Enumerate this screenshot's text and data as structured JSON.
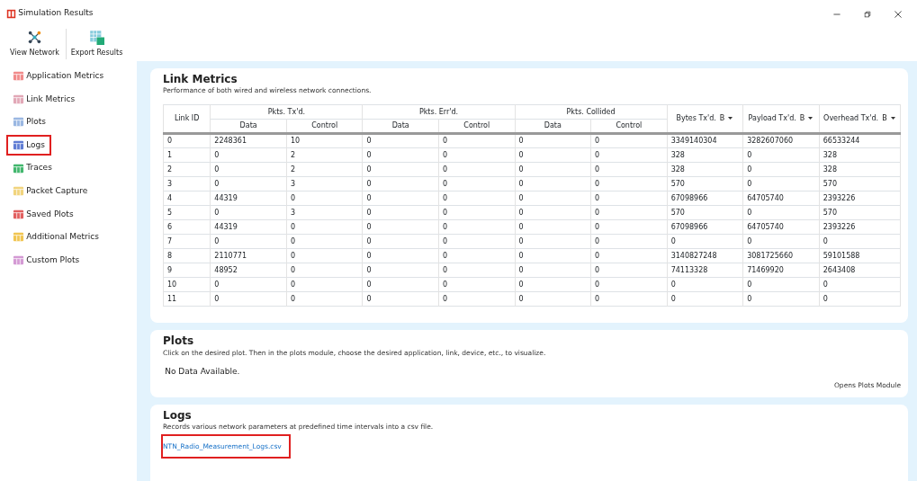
{
  "window": {
    "title": "Simulation Results"
  },
  "toolbar": [
    {
      "kind": "network",
      "label": "View Network"
    },
    {
      "kind": "export",
      "label": "Export Results"
    }
  ],
  "sidebar": {
    "items": [
      {
        "kind": "app",
        "label": "Application Metrics",
        "highlighted": false
      },
      {
        "kind": "link",
        "label": "Link Metrics",
        "highlighted": false
      },
      {
        "kind": "plots",
        "label": "Plots",
        "highlighted": false
      },
      {
        "kind": "logs",
        "label": "Logs",
        "highlighted": true
      },
      {
        "kind": "traces",
        "label": "Traces",
        "highlighted": false
      },
      {
        "kind": "capture",
        "label": "Packet Capture",
        "highlighted": false
      },
      {
        "kind": "saved",
        "label": "Saved Plots",
        "highlighted": false
      },
      {
        "kind": "additional",
        "label": "Additional Metrics",
        "highlighted": false
      },
      {
        "kind": "custom",
        "label": "Custom Plots",
        "highlighted": false
      }
    ]
  },
  "link_metrics": {
    "title": "Link Metrics",
    "subtitle": "Performance of both wired and wireless network connections.",
    "table": {
      "id_column": "Link ID",
      "groups": [
        {
          "label": "Pkts. Tx'd.",
          "columns": [
            "Data",
            "Control"
          ]
        },
        {
          "label": "Pkts. Err'd.",
          "columns": [
            "Data",
            "Control"
          ]
        },
        {
          "label": "Pkts. Collided",
          "columns": [
            "Data",
            "Control"
          ]
        }
      ],
      "unit_columns": [
        {
          "label": "Bytes Tx'd.",
          "unit": "B"
        },
        {
          "label": "Payload Tx'd.",
          "unit": "B"
        },
        {
          "label": "Overhead Tx'd.",
          "unit": "B"
        }
      ],
      "rows": [
        [
          "0",
          "2248361",
          "10",
          "0",
          "0",
          "0",
          "0",
          "3349140304",
          "3282607060",
          "66533244"
        ],
        [
          "1",
          "0",
          "2",
          "0",
          "0",
          "0",
          "0",
          "328",
          "0",
          "328"
        ],
        [
          "2",
          "0",
          "2",
          "0",
          "0",
          "0",
          "0",
          "328",
          "0",
          "328"
        ],
        [
          "3",
          "0",
          "3",
          "0",
          "0",
          "0",
          "0",
          "570",
          "0",
          "570"
        ],
        [
          "4",
          "44319",
          "0",
          "0",
          "0",
          "0",
          "0",
          "67098966",
          "64705740",
          "2393226"
        ],
        [
          "5",
          "0",
          "3",
          "0",
          "0",
          "0",
          "0",
          "570",
          "0",
          "570"
        ],
        [
          "6",
          "44319",
          "0",
          "0",
          "0",
          "0",
          "0",
          "67098966",
          "64705740",
          "2393226"
        ],
        [
          "7",
          "0",
          "0",
          "0",
          "0",
          "0",
          "0",
          "0",
          "0",
          "0"
        ],
        [
          "8",
          "2110771",
          "0",
          "0",
          "0",
          "0",
          "0",
          "3140827248",
          "3081725660",
          "59101588"
        ],
        [
          "9",
          "48952",
          "0",
          "0",
          "0",
          "0",
          "0",
          "74113328",
          "71469920",
          "2643408"
        ],
        [
          "10",
          "0",
          "0",
          "0",
          "0",
          "0",
          "0",
          "0",
          "0",
          "0"
        ],
        [
          "11",
          "0",
          "0",
          "0",
          "0",
          "0",
          "0",
          "0",
          "0",
          "0"
        ]
      ]
    }
  },
  "plots": {
    "title": "Plots",
    "subtitle": "Click on the desired plot. Then in the plots module, choose the desired application, link, device, etc., to visualize.",
    "empty_text": "No Data Available.",
    "link": "Opens Plots Module"
  },
  "logs": {
    "title": "Logs",
    "subtitle": "Records various network parameters at predefined time intervals into a csv file.",
    "files": [
      {
        "name": "NTN_Radio_Measurement_Logs.csv",
        "highlighted": true
      }
    ]
  }
}
